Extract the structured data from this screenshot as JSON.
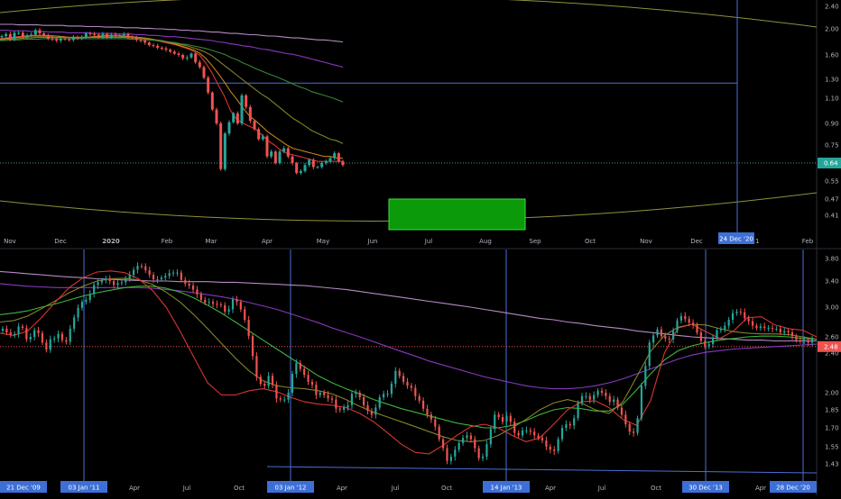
{
  "colors": {
    "background": "#000000",
    "axis_text": "#b2b5be",
    "separator": "#2a2e39",
    "candle_up": "#26a69a",
    "candle_down": "#ef5350",
    "wick": "#cccccc",
    "ma_red": "#e53935",
    "ma_orange": "#d18a1a",
    "ma_olive": "#8a8a2a",
    "ma_green": "#3d8a3d",
    "ma_bright_green": "#3fbf3f",
    "ma_purple": "#8e3cc8",
    "ma_lavender": "#c090d0",
    "line_blue": "#4a6fd8",
    "arc_yellow": "#b5b54a",
    "box_green": "#0a9a0a",
    "price_label": "#26a69a",
    "price_label_down": "#ef5350",
    "date_label": "#3d6fd6"
  },
  "chart_data": [
    {
      "type": "candlestick",
      "panel": "top",
      "y_axis_labels": [
        "2.40",
        "2.00",
        "1.60",
        "1.30",
        "1.10",
        "0.90",
        "0.75",
        "0.64",
        "0.55",
        "0.47",
        "0.41"
      ],
      "y_axis_values": [
        2.4,
        2.0,
        1.6,
        1.3,
        1.1,
        0.9,
        0.75,
        0.64,
        0.55,
        0.47,
        0.41
      ],
      "x_axis_labels": [
        "Nov",
        "Dec",
        "2020",
        "Feb",
        "Mar",
        "Apr",
        "May",
        "Jun",
        "Jul",
        "Aug",
        "Sep",
        "Oct",
        "Nov",
        "Dec",
        "'21",
        "Feb"
      ],
      "current_price": 0.64,
      "current_price_label": "0.64",
      "marked_date_label": "24 Dec '20",
      "horizontal_level": 1.26,
      "highlight_box": {
        "y_low": 0.41,
        "y_high": 0.47
      },
      "closes": [
        1.89,
        1.92,
        1.84,
        1.94,
        1.94,
        1.87,
        1.9,
        1.91,
        1.98,
        1.93,
        1.9,
        1.85,
        1.84,
        1.82,
        1.85,
        1.84,
        1.83,
        1.87,
        1.86,
        1.87,
        1.93,
        1.92,
        1.91,
        1.88,
        1.92,
        1.87,
        1.91,
        1.89,
        1.9,
        1.92,
        1.87,
        1.86,
        1.83,
        1.82,
        1.79,
        1.75,
        1.74,
        1.71,
        1.7,
        1.68,
        1.65,
        1.62,
        1.6,
        1.56,
        1.57,
        1.62,
        1.51,
        1.45,
        1.32,
        1.16,
        1.01,
        0.9,
        0.61,
        0.83,
        0.91,
        0.98,
        0.9,
        1.13,
        1.03,
        0.92,
        0.86,
        0.79,
        0.81,
        0.68,
        0.71,
        0.64,
        0.71,
        0.73,
        0.68,
        0.64,
        0.59,
        0.6,
        0.63,
        0.66,
        0.62,
        0.62,
        0.64,
        0.65,
        0.67,
        0.7,
        0.65,
        0.63
      ],
      "series": [
        {
          "name": "",
          "color_key": "ma_red",
          "values": [
            1.85,
            1.86,
            1.87,
            1.88,
            1.89,
            1.9,
            1.9,
            1.9,
            1.9,
            1.89,
            1.88,
            1.87,
            1.86,
            1.86,
            1.87,
            1.88,
            1.89,
            1.9,
            1.9,
            1.9,
            1.89,
            1.88,
            1.87,
            1.86,
            1.84,
            1.82,
            1.8,
            1.78,
            1.76,
            1.73,
            1.7,
            1.66,
            1.6,
            1.5,
            1.38,
            1.24,
            1.12,
            1.0,
            0.93,
            0.9,
            0.88,
            0.86,
            0.82,
            0.78,
            0.75,
            0.72,
            0.7,
            0.69,
            0.68,
            0.67,
            0.66,
            0.65,
            0.65,
            0.65,
            0.65,
            0.65
          ]
        },
        {
          "name": "",
          "color_key": "ma_orange",
          "values": [
            1.84,
            1.85,
            1.86,
            1.87,
            1.88,
            1.89,
            1.89,
            1.89,
            1.89,
            1.89,
            1.88,
            1.87,
            1.87,
            1.87,
            1.87,
            1.88,
            1.88,
            1.89,
            1.89,
            1.89,
            1.88,
            1.88,
            1.87,
            1.86,
            1.85,
            1.83,
            1.81,
            1.79,
            1.77,
            1.74,
            1.71,
            1.68,
            1.63,
            1.56,
            1.47,
            1.37,
            1.27,
            1.17,
            1.09,
            1.02,
            0.96,
            0.92,
            0.88,
            0.84,
            0.81,
            0.78,
            0.75,
            0.73,
            0.72,
            0.71,
            0.7,
            0.69,
            0.68,
            0.68,
            0.67,
            0.67
          ]
        },
        {
          "name": "",
          "color_key": "ma_olive",
          "values": [
            1.83,
            1.84,
            1.84,
            1.85,
            1.86,
            1.86,
            1.87,
            1.87,
            1.87,
            1.87,
            1.87,
            1.87,
            1.87,
            1.87,
            1.87,
            1.87,
            1.87,
            1.87,
            1.87,
            1.87,
            1.87,
            1.86,
            1.86,
            1.85,
            1.84,
            1.83,
            1.82,
            1.8,
            1.78,
            1.76,
            1.74,
            1.71,
            1.68,
            1.64,
            1.59,
            1.53,
            1.47,
            1.41,
            1.35,
            1.29,
            1.24,
            1.19,
            1.14,
            1.1,
            1.06,
            1.02,
            0.98,
            0.94,
            0.91,
            0.88,
            0.85,
            0.83,
            0.81,
            0.79,
            0.78,
            0.76
          ]
        },
        {
          "name": "",
          "color_key": "ma_green",
          "values": [
            1.82,
            1.82,
            1.83,
            1.83,
            1.84,
            1.84,
            1.84,
            1.85,
            1.85,
            1.85,
            1.85,
            1.85,
            1.85,
            1.85,
            1.85,
            1.85,
            1.85,
            1.85,
            1.85,
            1.85,
            1.85,
            1.84,
            1.84,
            1.83,
            1.83,
            1.82,
            1.81,
            1.8,
            1.79,
            1.77,
            1.76,
            1.74,
            1.72,
            1.7,
            1.67,
            1.64,
            1.61,
            1.57,
            1.54,
            1.5,
            1.47,
            1.43,
            1.4,
            1.37,
            1.34,
            1.31,
            1.28,
            1.25,
            1.22,
            1.2,
            1.17,
            1.15,
            1.13,
            1.11,
            1.09,
            1.07
          ]
        },
        {
          "name": "",
          "color_key": "ma_purple",
          "values": [
            1.98,
            1.98,
            1.97,
            1.97,
            1.97,
            1.96,
            1.96,
            1.96,
            1.95,
            1.95,
            1.95,
            1.94,
            1.94,
            1.94,
            1.94,
            1.93,
            1.93,
            1.93,
            1.93,
            1.92,
            1.92,
            1.92,
            1.91,
            1.91,
            1.9,
            1.9,
            1.89,
            1.88,
            1.88,
            1.87,
            1.86,
            1.85,
            1.84,
            1.83,
            1.82,
            1.8,
            1.79,
            1.77,
            1.76,
            1.74,
            1.73,
            1.71,
            1.69,
            1.68,
            1.66,
            1.64,
            1.62,
            1.61,
            1.59,
            1.57,
            1.55,
            1.53,
            1.51,
            1.49,
            1.47,
            1.45
          ]
        },
        {
          "name": "",
          "color_key": "ma_lavender",
          "values": [
            2.08,
            2.08,
            2.08,
            2.07,
            2.07,
            2.07,
            2.07,
            2.06,
            2.06,
            2.06,
            2.06,
            2.05,
            2.05,
            2.05,
            2.04,
            2.04,
            2.04,
            2.03,
            2.03,
            2.03,
            2.02,
            2.02,
            2.02,
            2.01,
            2.01,
            2.0,
            2.0,
            1.99,
            1.99,
            1.98,
            1.98,
            1.97,
            1.97,
            1.96,
            1.95,
            1.95,
            1.94,
            1.93,
            1.93,
            1.92,
            1.91,
            1.91,
            1.9,
            1.89,
            1.89,
            1.88,
            1.87,
            1.86,
            1.86,
            1.85,
            1.84,
            1.83,
            1.83,
            1.82,
            1.81,
            1.8
          ]
        }
      ]
    },
    {
      "type": "candlestick",
      "panel": "bottom",
      "y_axis_labels": [
        "3.80",
        "3.40",
        "3.00",
        "2.60",
        "2.40",
        "2.00",
        "1.85",
        "1.70",
        "1.55",
        "1.43"
      ],
      "y_axis_values": [
        3.8,
        3.4,
        3.0,
        2.6,
        2.4,
        2.0,
        1.85,
        1.7,
        1.55,
        1.43
      ],
      "x_axis_labels": [
        "21 Dec '09",
        "03 Jan '11",
        "Apr",
        "Jul",
        "Oct",
        "03 Jan '12",
        "Apr",
        "Jul",
        "Oct",
        "14 Jan '13",
        "Apr",
        "Jul",
        "Oct",
        "30 Dec '13",
        "Apr",
        "28 Dec '20"
      ],
      "current_price": 2.48,
      "current_price_label": "2.48",
      "closes": [
        2.71,
        2.66,
        2.63,
        2.64,
        2.74,
        2.72,
        2.57,
        2.6,
        2.69,
        2.65,
        2.53,
        2.44,
        2.57,
        2.58,
        2.64,
        2.56,
        2.54,
        2.71,
        2.86,
        2.99,
        3.08,
        3.11,
        3.2,
        3.34,
        3.38,
        3.41,
        3.44,
        3.4,
        3.34,
        3.37,
        3.38,
        3.44,
        3.51,
        3.6,
        3.67,
        3.66,
        3.59,
        3.51,
        3.43,
        3.43,
        3.46,
        3.49,
        3.54,
        3.55,
        3.55,
        3.42,
        3.36,
        3.33,
        3.27,
        3.2,
        3.11,
        3.07,
        3.08,
        3.05,
        3.04,
        3.03,
        2.94,
        2.97,
        3.12,
        3.08,
        2.97,
        2.83,
        2.61,
        2.37,
        2.16,
        2.09,
        2.07,
        2.17,
        2.08,
        1.95,
        1.94,
        1.94,
        2.0,
        2.19,
        2.3,
        2.24,
        2.18,
        2.11,
        2.08,
        1.98,
        2.0,
        1.98,
        1.95,
        1.94,
        1.86,
        1.85,
        1.87,
        1.89,
        1.99,
        2.0,
        1.96,
        1.89,
        1.84,
        1.81,
        1.87,
        1.96,
        1.99,
        1.99,
        2.09,
        2.22,
        2.17,
        2.11,
        2.07,
        2.05,
        1.97,
        1.93,
        1.86,
        1.81,
        1.77,
        1.71,
        1.61,
        1.54,
        1.45,
        1.48,
        1.53,
        1.58,
        1.62,
        1.64,
        1.61,
        1.54,
        1.47,
        1.48,
        1.57,
        1.69,
        1.81,
        1.79,
        1.75,
        1.8,
        1.75,
        1.66,
        1.64,
        1.68,
        1.68,
        1.67,
        1.64,
        1.62,
        1.6,
        1.55,
        1.53,
        1.52,
        1.61,
        1.7,
        1.73,
        1.72,
        1.78,
        1.91,
        1.97,
        1.97,
        1.94,
        1.98,
        2.02,
        2.0,
        1.97,
        1.92,
        1.94,
        1.87,
        1.81,
        1.73,
        1.67,
        1.66,
        1.78,
        2.07,
        2.27,
        2.53,
        2.62,
        2.7,
        2.61,
        2.58,
        2.57,
        2.68,
        2.82,
        2.88,
        2.84,
        2.79,
        2.76,
        2.66,
        2.55,
        2.49,
        2.51,
        2.59,
        2.69,
        2.7,
        2.75,
        2.83,
        2.92,
        2.94,
        2.93,
        2.85,
        2.81,
        2.75,
        2.72,
        2.74,
        2.72,
        2.72,
        2.71,
        2.71,
        2.66,
        2.68,
        2.66,
        2.61,
        2.56,
        2.55,
        2.56,
        2.53,
        2.57
      ],
      "series": [
        {
          "name": "",
          "color_key": "ma_lavender",
          "values": [
            3.57,
            3.55,
            3.53,
            3.51,
            3.49,
            3.47,
            3.46,
            3.44,
            3.43,
            3.42,
            3.41,
            3.4,
            3.4,
            3.39,
            3.39,
            3.39,
            3.38,
            3.38,
            3.37,
            3.36,
            3.35,
            3.34,
            3.33,
            3.31,
            3.29,
            3.27,
            3.24,
            3.21,
            3.18,
            3.15,
            3.12,
            3.09,
            3.06,
            3.03,
            3.0,
            2.97,
            2.94,
            2.91,
            2.88,
            2.85,
            2.83,
            2.8,
            2.78,
            2.75,
            2.73,
            2.71,
            2.68,
            2.66,
            2.64,
            2.62,
            2.6,
            2.59,
            2.58,
            2.57,
            2.56,
            2.56,
            2.55,
            2.55,
            2.55,
            2.55
          ]
        },
        {
          "name": "",
          "color_key": "ma_purple",
          "values": [
            3.36,
            3.34,
            3.32,
            3.31,
            3.3,
            3.3,
            3.3,
            3.3,
            3.3,
            3.3,
            3.3,
            3.29,
            3.27,
            3.25,
            3.22,
            3.19,
            3.16,
            3.12,
            3.07,
            3.02,
            2.97,
            2.91,
            2.85,
            2.79,
            2.72,
            2.66,
            2.6,
            2.54,
            2.48,
            2.42,
            2.37,
            2.32,
            2.28,
            2.24,
            2.2,
            2.16,
            2.13,
            2.1,
            2.07,
            2.05,
            2.04,
            2.04,
            2.05,
            2.07,
            2.1,
            2.14,
            2.19,
            2.24,
            2.29,
            2.34,
            2.38,
            2.41,
            2.43,
            2.45,
            2.46,
            2.47,
            2.48,
            2.49,
            2.5,
            2.51
          ]
        },
        {
          "name": "",
          "color_key": "ma_bright_green",
          "values": [
            2.9,
            2.92,
            2.95,
            3.0,
            3.05,
            3.11,
            3.17,
            3.22,
            3.26,
            3.3,
            3.32,
            3.32,
            3.29,
            3.23,
            3.14,
            3.03,
            2.92,
            2.8,
            2.68,
            2.56,
            2.45,
            2.35,
            2.26,
            2.17,
            2.1,
            2.04,
            1.99,
            1.94,
            1.9,
            1.86,
            1.83,
            1.8,
            1.77,
            1.74,
            1.72,
            1.7,
            1.7,
            1.72,
            1.76,
            1.81,
            1.85,
            1.87,
            1.86,
            1.84,
            1.84,
            1.9,
            2.03,
            2.19,
            2.33,
            2.43,
            2.49,
            2.53,
            2.56,
            2.58,
            2.6,
            2.61,
            2.61,
            2.6,
            2.58,
            2.57
          ]
        },
        {
          "name": "",
          "color_key": "ma_olive",
          "values": [
            2.8,
            2.82,
            2.88,
            2.98,
            3.1,
            3.22,
            3.32,
            3.4,
            3.44,
            3.45,
            3.42,
            3.35,
            3.23,
            3.08,
            2.9,
            2.71,
            2.52,
            2.35,
            2.22,
            2.12,
            2.07,
            2.05,
            2.04,
            2.02,
            1.99,
            1.94,
            1.88,
            1.83,
            1.79,
            1.75,
            1.71,
            1.67,
            1.63,
            1.6,
            1.59,
            1.6,
            1.64,
            1.7,
            1.77,
            1.85,
            1.91,
            1.94,
            1.91,
            1.85,
            1.82,
            1.92,
            2.16,
            2.42,
            2.62,
            2.73,
            2.77,
            2.76,
            2.71,
            2.67,
            2.65,
            2.64,
            2.64,
            2.63,
            2.6,
            2.57
          ]
        },
        {
          "name": "",
          "color_key": "ma_red",
          "values": [
            2.65,
            2.62,
            2.68,
            2.86,
            3.08,
            3.3,
            3.46,
            3.56,
            3.58,
            3.55,
            3.44,
            3.26,
            3.0,
            2.68,
            2.36,
            2.1,
            1.98,
            1.98,
            2.02,
            2.04,
            2.01,
            1.96,
            1.92,
            1.9,
            1.89,
            1.87,
            1.82,
            1.75,
            1.66,
            1.57,
            1.51,
            1.5,
            1.56,
            1.64,
            1.71,
            1.73,
            1.7,
            1.64,
            1.59,
            1.62,
            1.73,
            1.85,
            1.92,
            1.93,
            1.87,
            1.77,
            1.72,
            1.93,
            2.4,
            2.72,
            2.77,
            2.67,
            2.58,
            2.68,
            2.86,
            2.87,
            2.76,
            2.71,
            2.69,
            2.6
          ]
        }
      ]
    }
  ]
}
